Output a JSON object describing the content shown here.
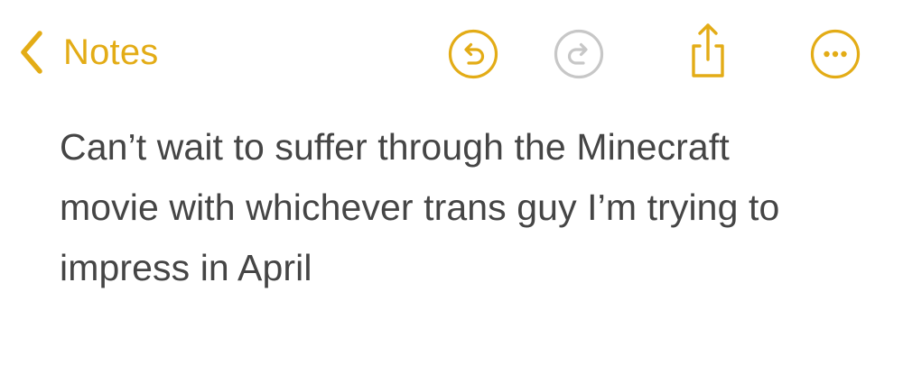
{
  "toolbar": {
    "back_label": "Notes",
    "accent_color": "#E3AC16",
    "disabled_color": "#C7C7C7",
    "icons": [
      "chevron-left-icon",
      "undo-icon",
      "redo-icon",
      "share-icon",
      "more-icon"
    ]
  },
  "note": {
    "lines": [
      "Can’t wait to suffer through the Minecraft",
      "movie with whichever trans guy I’m trying to",
      "impress in April"
    ],
    "text_color": "#454545"
  }
}
